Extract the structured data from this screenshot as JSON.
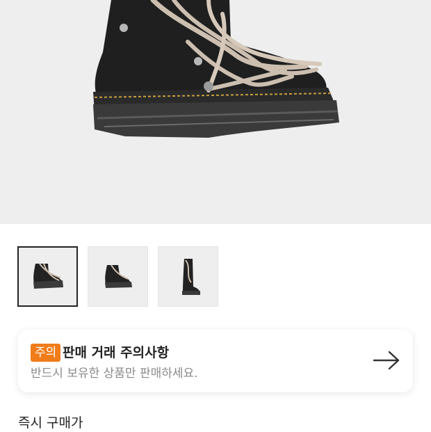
{
  "product": {
    "image_alt": "black-leather-boot-with-beige-laces",
    "thumbnails": [
      {
        "name": "side-view",
        "selected": true
      },
      {
        "name": "three-quarter-view",
        "selected": false
      },
      {
        "name": "tall-boot-view",
        "selected": false
      }
    ]
  },
  "notice": {
    "badge": "주의",
    "title": "판매 거래 주의사항",
    "subtitle": "반드시 보유한 상품만 판매하세요.",
    "badge_color": "#f07c1a",
    "action_icon": "arrow-right-icon"
  },
  "section": {
    "title": "즉시 구매가"
  }
}
